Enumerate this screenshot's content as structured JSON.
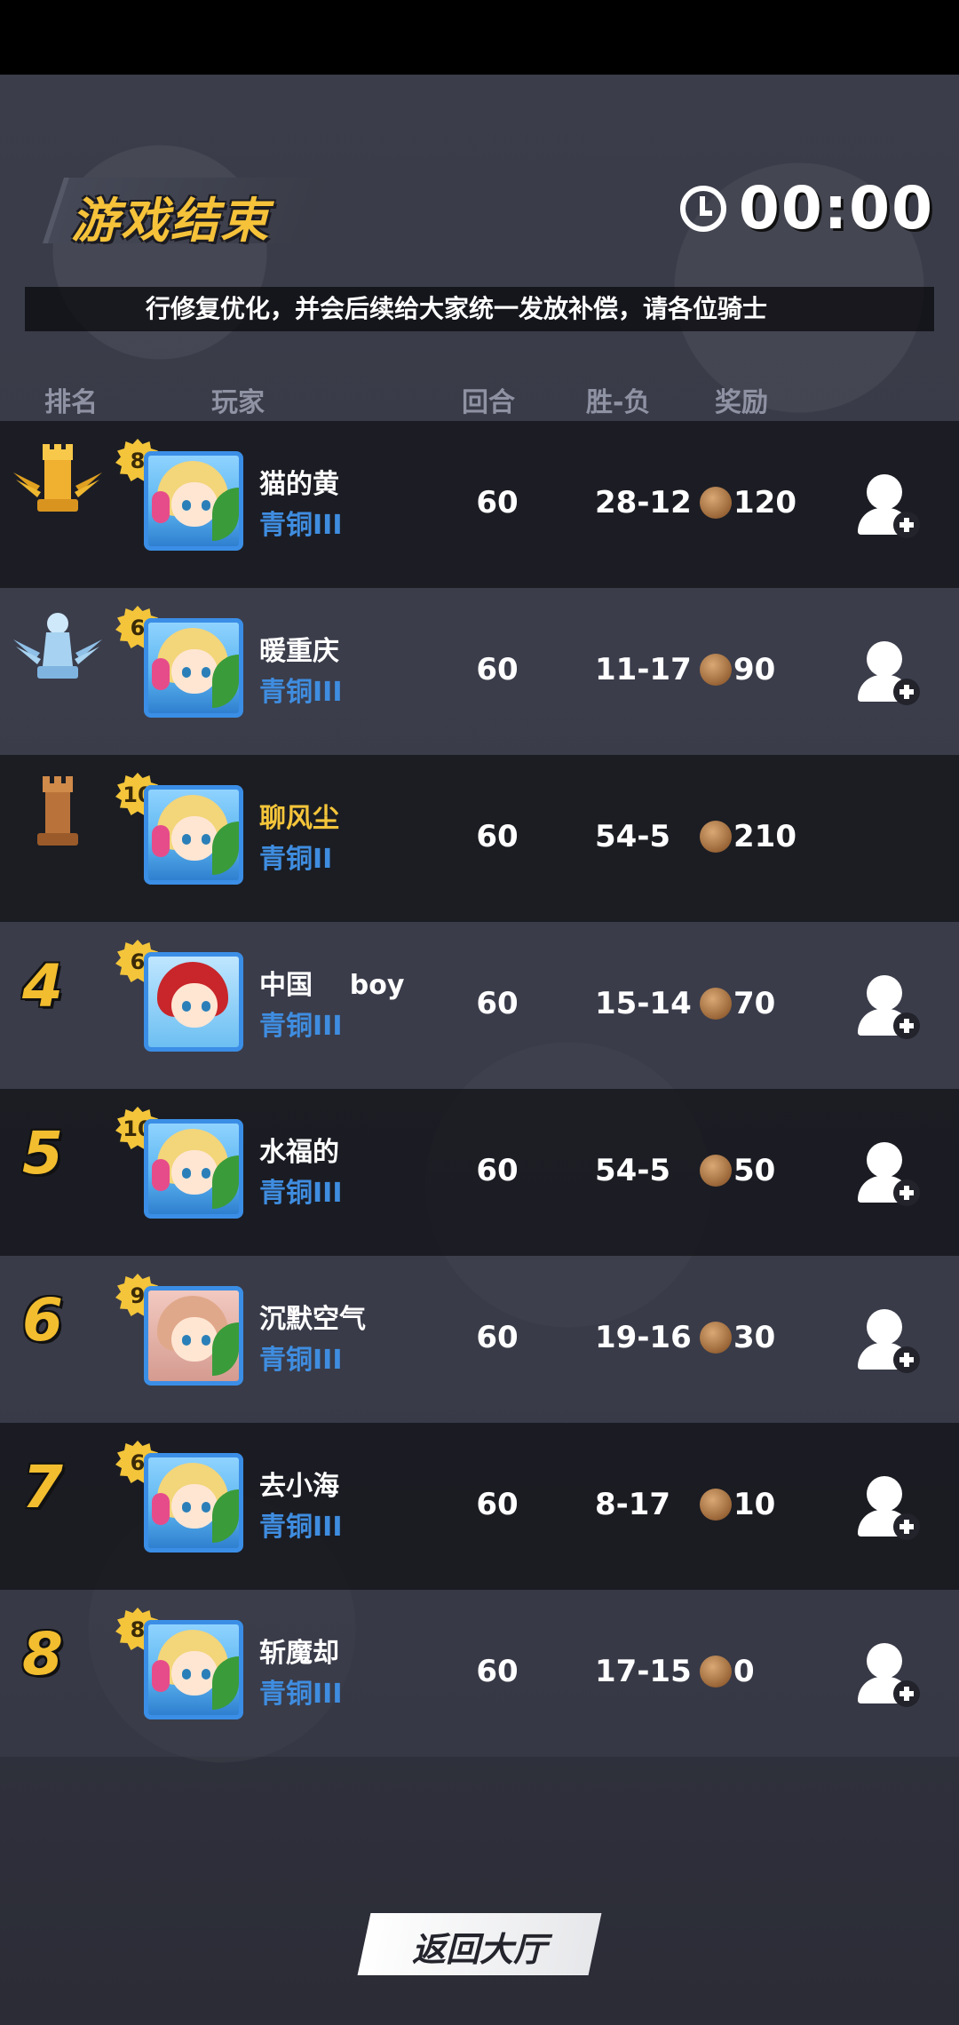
{
  "header": {
    "title": "游戏结束",
    "timer": "00:00"
  },
  "marquee": "行修复优化，并会后续给大家统一发放补偿，请各位骑士",
  "columns": {
    "rank": "排名",
    "player": "玩家",
    "rounds": "回合",
    "win_loss": "胜-负",
    "reward": "奖励"
  },
  "rows": [
    {
      "rank": "1",
      "level": "8",
      "name": "猫的黄",
      "tier": "青铜III",
      "rounds": "60",
      "wl": "28-12",
      "reward": "120"
    },
    {
      "rank": "2",
      "level": "6",
      "name": "暖重庆",
      "tier": "青铜III",
      "rounds": "60",
      "wl": "11-17",
      "reward": "90"
    },
    {
      "rank": "3",
      "level": "10",
      "name": "聊风尘",
      "tier": "青铜II",
      "rounds": "60",
      "wl": "54-5",
      "reward": "210"
    },
    {
      "rank": "4",
      "level": "6",
      "name": "中国    boy",
      "tier": "青铜III",
      "rounds": "60",
      "wl": "15-14",
      "reward": "70"
    },
    {
      "rank": "5",
      "level": "10",
      "name": "水福的",
      "tier": "青铜III",
      "rounds": "60",
      "wl": "54-5",
      "reward": "50"
    },
    {
      "rank": "6",
      "level": "9",
      "name": "沉默空气",
      "tier": "青铜III",
      "rounds": "60",
      "wl": "19-16",
      "reward": "30"
    },
    {
      "rank": "7",
      "level": "6",
      "name": "去小海",
      "tier": "青铜III",
      "rounds": "60",
      "wl": "8-17",
      "reward": "10"
    },
    {
      "rank": "8",
      "level": "8",
      "name": "斩魔却",
      "tier": "青铜III",
      "rounds": "60",
      "wl": "17-15",
      "reward": "0"
    }
  ],
  "footer": {
    "return_label": "返回大厅"
  },
  "colors": {
    "gold": "#f4c53a",
    "tier_blue": "#3f8de0",
    "header_text": "#8f92a3"
  }
}
